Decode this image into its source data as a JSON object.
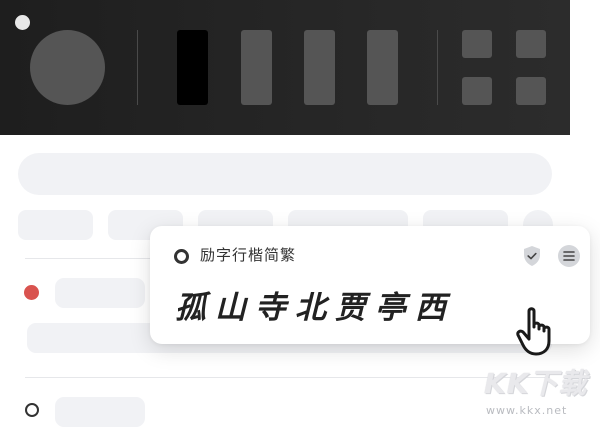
{
  "font_card": {
    "title": "励字行楷简繁",
    "sample": "孤山寺北贾亭西"
  },
  "icons": {
    "shield": "shield-check-icon",
    "menu": "menu-icon",
    "hand": "hand-pointer-icon"
  },
  "watermark": {
    "logo": "KK下载",
    "url": "www.kkx.net"
  },
  "colors": {
    "toolbar_bg": "#262626",
    "accent_red": "#d9534f",
    "skeleton": "#f1f2f5"
  }
}
